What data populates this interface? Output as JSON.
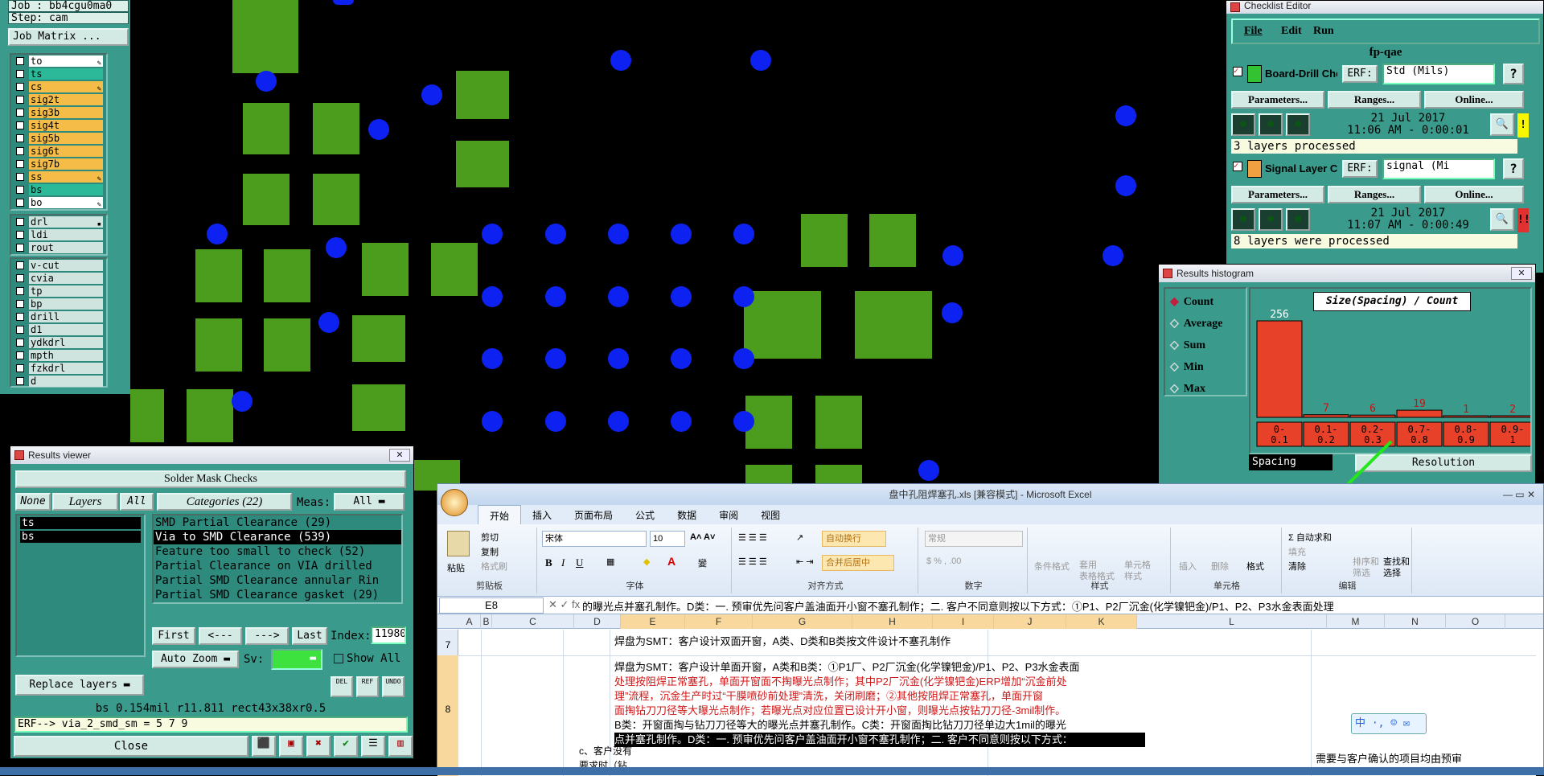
{
  "left_panel": {
    "job": "Job : bb4cgu0ma0",
    "step": "Step: cam",
    "job_matrix": "Job Matrix ...",
    "layers_group1": [
      {
        "name": "to",
        "color": "#ffffff",
        "flag": "✎"
      },
      {
        "name": "ts",
        "color": "#2bb99a",
        "flag": ""
      },
      {
        "name": "cs",
        "color": "#f5bd47",
        "flag": "✎"
      },
      {
        "name": "sig2t",
        "color": "#f5bd47",
        "flag": ""
      },
      {
        "name": "sig3b",
        "color": "#f5bd47",
        "flag": ""
      },
      {
        "name": "sig4t",
        "color": "#f5bd47",
        "flag": ""
      },
      {
        "name": "sig5b",
        "color": "#f5bd47",
        "flag": ""
      },
      {
        "name": "sig6t",
        "color": "#f5bd47",
        "flag": ""
      },
      {
        "name": "sig7b",
        "color": "#f5bd47",
        "flag": ""
      },
      {
        "name": "ss",
        "color": "#f5bd47",
        "flag": "✎"
      },
      {
        "name": "bs",
        "color": "#2bb99a",
        "flag": ""
      },
      {
        "name": "bo",
        "color": "#ffffff",
        "flag": "✎"
      }
    ],
    "layers_group2": [
      {
        "name": "drl",
        "color": "#cfe3df",
        "flag": "▪"
      },
      {
        "name": "ldi",
        "color": "#cfe3df",
        "flag": ""
      },
      {
        "name": "rout",
        "color": "#cfe3df",
        "flag": ""
      }
    ],
    "layers_group3": [
      {
        "name": "v-cut",
        "color": "#cfe3df"
      },
      {
        "name": "cvia",
        "color": "#cfe3df"
      },
      {
        "name": "tp",
        "color": "#cfe3df"
      },
      {
        "name": "bp",
        "color": "#cfe3df"
      },
      {
        "name": "drill",
        "color": "#cfe3df"
      },
      {
        "name": "d1",
        "color": "#cfe3df"
      },
      {
        "name": "ydkdrl",
        "color": "#cfe3df"
      },
      {
        "name": "mpth",
        "color": "#cfe3df"
      },
      {
        "name": "fzkdrl",
        "color": "#cfe3df"
      },
      {
        "name": "d",
        "color": "#cfe3df"
      }
    ]
  },
  "results_viewer": {
    "title": "Results viewer",
    "header": "Solder Mask Checks",
    "none": "None",
    "layers": "Layers",
    "all": "All",
    "categories": "Categories (22)",
    "meas_label": "Meas:",
    "meas_value": "All",
    "layer_list": [
      "ts",
      "bs"
    ],
    "category_list": [
      "SMD Partial Clearance (29)",
      "Via to SMD Clearance (539)",
      "Feature too small to check (52)",
      "Partial Clearance on VIA drilled",
      "Partial SMD Clearance annular Rin",
      "Partial SMD Clearance gasket (29)"
    ],
    "first": "First",
    "prev": "<---",
    "next": "--->",
    "last": "Last",
    "index_label": "Index:",
    "index_value": "11980",
    "auto_zoom": "Auto Zoom",
    "sv_label": "Sv:",
    "show_all": "Show All",
    "replace_layers": "Replace layers",
    "del": "DEL",
    "ref": "REF",
    "undo": "UNDO",
    "status": "bs 0.154mil  r11.811  rect43x38xr0.5",
    "erf": "ERF--> via_2_smd_sm = 5 7 9",
    "close": "Close"
  },
  "checklist": {
    "title": "Checklist Editor",
    "menu": [
      "File",
      "Edit",
      "Run"
    ],
    "name": "fp-qae",
    "entries": [
      {
        "label": "Board-Drill Che",
        "erf_label": "ERF:",
        "erf_value": "Std (Mils)",
        "date": "21 Jul 2017",
        "time": "11:06 AM - 0:00:01",
        "status": "3 layers processed",
        "mark": "!",
        "mark_color": "#f7f700"
      },
      {
        "label": "Signal Layer Ch",
        "erf_label": "ERF:",
        "erf_value": "signal (Mi",
        "date": "21 Jul 2017",
        "time": "11:07 AM - 0:00:49",
        "status": "8 layers were processed",
        "mark": "!!",
        "mark_color": "#e03030"
      }
    ],
    "params": "Parameters...",
    "ranges": "Ranges...",
    "online": "Online..."
  },
  "histogram": {
    "title": "Results histogram",
    "modes": [
      "Count",
      "Average",
      "Sum",
      "Min",
      "Max"
    ],
    "selected_mode": "Count",
    "resolution": "Resolution",
    "spacing": "Spacing"
  },
  "chart_data": {
    "type": "bar",
    "title": "Size(Spacing) / Count",
    "categories": [
      "0-0.1",
      "0.1-0.2",
      "0.2-0.3",
      "0.7-0.8",
      "0.8-0.9",
      "0.9-1"
    ],
    "values": [
      256,
      7,
      6,
      19,
      1,
      2
    ],
    "ylim": [
      0,
      256
    ],
    "color": "#e8412a"
  },
  "excel": {
    "title": "盘中孔阻焊塞孔.xls  [兼容模式]  -  Microsoft Excel",
    "tabs": [
      "开始",
      "插入",
      "页面布局",
      "公式",
      "数据",
      "审阅",
      "视图"
    ],
    "clipboard": {
      "paste": "粘贴",
      "cut": "剪切",
      "copy": "复制",
      "format": "格式刷",
      "label": "剪贴板"
    },
    "font": {
      "name": "宋体",
      "size": "10",
      "label": "字体"
    },
    "align": {
      "wrap": "自动换行",
      "merge": "合并后居中",
      "label": "对齐方式"
    },
    "number": {
      "format": "常规",
      "label": "数字"
    },
    "styles": {
      "cond": "条件格式",
      "table": "套用\n表格格式",
      "cell": "单元格\n样式",
      "label": "样式"
    },
    "cells": {
      "insert": "插入",
      "delete": "删除",
      "format": "格式",
      "label": "单元格"
    },
    "edit": {
      "autosum": "自动求和",
      "fill": "填充",
      "clear": "清除",
      "sort": "排序和\n筛选",
      "find": "查找和\n选择",
      "label": "编辑"
    },
    "name_box": "E8",
    "formula": "的曝光点并塞孔制作。D类：一. 预审优先问客户盖油面开小窗不塞孔制作；二. 客户不同意则按以下方式：①P1、P2厂沉金(化学镍钯金)/P1、P2、P3水金表面处理",
    "columns": [
      "A",
      "B",
      "C",
      "D",
      "E",
      "F",
      "G",
      "H",
      "I",
      "J",
      "K",
      "L",
      "M",
      "N",
      "O"
    ],
    "row7": "焊盘为SMT：客户设计双面开窗，A类、D类和B类按文件设计不塞孔制作",
    "row8_lines": [
      "焊盘为SMT：客户设计单面开窗，A类和B类：①P1厂、P2厂沉金(化学镍钯金)/P1、P2、P3水金表面",
      "处理按阻焊正常塞孔，单面开窗面不掏曝光点制作；其中P2厂沉金(化学镍钯金)ERP增加“沉金前处",
      "理”流程，沉金生产时过“干膜喷砂前处理”清洗，关闭刷磨；②其他按阻焊正常塞孔，单面开窗",
      "面掏钻刀刀径等大曝光点制作；若曝光点对应位置已设计开小窗，则曝光点按钻刀刀径-3mil制作。",
      "B类：开窗面掏与钻刀刀径等大的曝光点并塞孔制作。C类：开窗面掏比钻刀刀径单边大1mil的曝光",
      "点并塞孔制作。D类：一. 预审优先问客户盖油面开小窗不塞孔制作；二. 客户不同意则按以下方式："
    ],
    "colD": "c、客户没有\n要求时（钻",
    "colL": "需要与客户确认的项目均由预审",
    "row_labels": [
      "7",
      "8"
    ]
  }
}
